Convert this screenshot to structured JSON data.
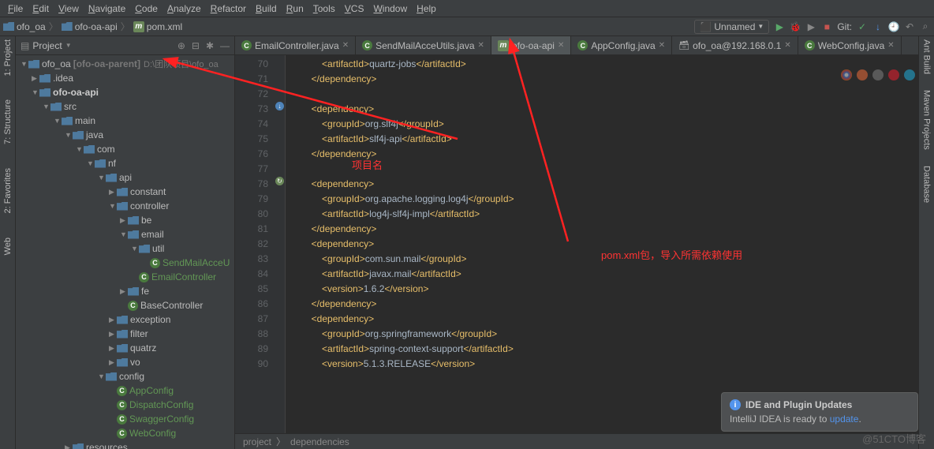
{
  "menu": [
    "File",
    "Edit",
    "View",
    "Navigate",
    "Code",
    "Analyze",
    "Refactor",
    "Build",
    "Run",
    "Tools",
    "VCS",
    "Window",
    "Help"
  ],
  "nav": {
    "root": "ofo_oa",
    "module": "ofo-oa-api",
    "file": "pom.xml"
  },
  "toolbar": {
    "run_config": "Unnamed",
    "git_label": "Git:"
  },
  "panel": {
    "title": "Project"
  },
  "tree": [
    {
      "d": 0,
      "a": "▼",
      "i": "folder",
      "t": "ofo_oa",
      "mod": "[ofo-oa-parent]",
      "path": "D:\\团队项目\\ofo_oa"
    },
    {
      "d": 1,
      "a": "▶",
      "i": "folder",
      "t": ".idea"
    },
    {
      "d": 1,
      "a": "▼",
      "i": "folder",
      "t": "ofo-oa-api",
      "bold": true
    },
    {
      "d": 2,
      "a": "▼",
      "i": "folder",
      "t": "src"
    },
    {
      "d": 3,
      "a": "▼",
      "i": "folder",
      "t": "main"
    },
    {
      "d": 4,
      "a": "▼",
      "i": "folder",
      "t": "java"
    },
    {
      "d": 5,
      "a": "▼",
      "i": "folder",
      "t": "com"
    },
    {
      "d": 6,
      "a": "▼",
      "i": "folder",
      "t": "nf"
    },
    {
      "d": 7,
      "a": "▼",
      "i": "folder",
      "t": "api"
    },
    {
      "d": 8,
      "a": "▶",
      "i": "folder",
      "t": "constant"
    },
    {
      "d": 8,
      "a": "▼",
      "i": "folder",
      "t": "controller"
    },
    {
      "d": 9,
      "a": "▶",
      "i": "folder",
      "t": "be"
    },
    {
      "d": 9,
      "a": "▼",
      "i": "folder",
      "t": "email"
    },
    {
      "d": 10,
      "a": "▼",
      "i": "folder",
      "t": "util"
    },
    {
      "d": 11,
      "a": "",
      "i": "class",
      "t": "SendMailAcceU",
      "green": true
    },
    {
      "d": 10,
      "a": "",
      "i": "class",
      "t": "EmailController",
      "green": true
    },
    {
      "d": 9,
      "a": "▶",
      "i": "folder",
      "t": "fe"
    },
    {
      "d": 9,
      "a": "",
      "i": "class",
      "t": "BaseController"
    },
    {
      "d": 8,
      "a": "▶",
      "i": "folder",
      "t": "exception"
    },
    {
      "d": 8,
      "a": "▶",
      "i": "folder",
      "t": "filter"
    },
    {
      "d": 8,
      "a": "▶",
      "i": "folder",
      "t": "quatrz"
    },
    {
      "d": 8,
      "a": "▶",
      "i": "folder",
      "t": "vo"
    },
    {
      "d": 7,
      "a": "▼",
      "i": "folder",
      "t": "config"
    },
    {
      "d": 8,
      "a": "",
      "i": "class",
      "t": "AppConfig",
      "green": true
    },
    {
      "d": 8,
      "a": "",
      "i": "class",
      "t": "DispatchConfig",
      "green": true
    },
    {
      "d": 8,
      "a": "",
      "i": "class",
      "t": "SwaggerConfig",
      "green": true
    },
    {
      "d": 8,
      "a": "",
      "i": "class",
      "t": "WebConfig",
      "green": true
    },
    {
      "d": 4,
      "a": "▶",
      "i": "folder",
      "t": "resources"
    }
  ],
  "tabs": [
    {
      "i": "class",
      "t": "EmailController.java"
    },
    {
      "i": "class",
      "t": "SendMailAcceUtils.java"
    },
    {
      "i": "maven",
      "t": "ofo-oa-api",
      "active": true
    },
    {
      "i": "class",
      "t": "AppConfig.java"
    },
    {
      "i": "db",
      "t": "ofo_oa@192.168.0.1"
    },
    {
      "i": "class",
      "t": "WebConfig.java"
    }
  ],
  "code": {
    "start": 70,
    "lines": [
      "            <artifactId>quartz-jobs</artifactId>",
      "        </dependency>",
      "",
      "        <dependency>",
      "            <groupId>org.slf4j</groupId>",
      "            <artifactId>slf4j-api</artifactId>",
      "        </dependency>",
      "",
      "        <dependency>",
      "            <groupId>org.apache.logging.log4j</groupId>",
      "            <artifactId>log4j-slf4j-impl</artifactId>",
      "        </dependency>",
      "        <dependency>",
      "            <groupId>com.sun.mail</groupId>",
      "            <artifactId>javax.mail</artifactId>",
      "            <version>1.6.2</version>",
      "        </dependency>",
      "        <dependency>",
      "            <groupId>org.springframework</groupId>",
      "            <artifactId>spring-context-support</artifactId>",
      "            <version>5.1.3.RELEASE</version>"
    ]
  },
  "annotations": {
    "project_name": "项目名",
    "pom_desc": "pom.xml包，导入所需依赖使用"
  },
  "breadcrumb": [
    "project",
    "dependencies"
  ],
  "notification": {
    "title": "IDE and Plugin Updates",
    "body_pre": "IntelliJ IDEA is ready to ",
    "link": "update",
    "body_post": "."
  },
  "side_left": [
    "1: Project",
    "7: Structure",
    "2: Favorites",
    "Web"
  ],
  "side_right": [
    "Ant Build",
    "Maven Projects",
    "Database"
  ],
  "watermark": "@51CTO博客"
}
